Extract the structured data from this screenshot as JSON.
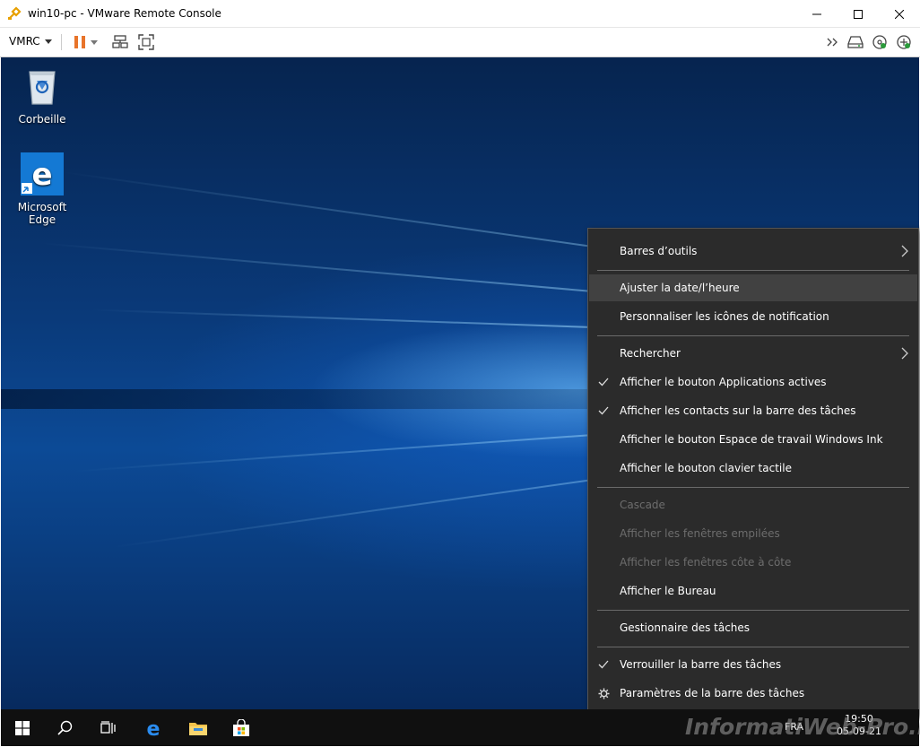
{
  "window": {
    "title": "win10-pc - VMware Remote Console"
  },
  "toolbar": {
    "vmrc_label": "VMRC"
  },
  "desktop": {
    "icons": [
      {
        "label": "Corbeille",
        "icon": "recycle-bin-icon"
      },
      {
        "label": "Microsoft Edge",
        "icon": "edge-icon"
      }
    ]
  },
  "context_menu": {
    "items": [
      {
        "label": "Barres d’outils",
        "submenu": true
      },
      {
        "label": "Ajuster la date/l’heure",
        "hover": true
      },
      {
        "label": "Personnaliser les icônes de notification"
      },
      {
        "label": "Rechercher",
        "submenu": true
      },
      {
        "label": "Afficher le bouton Applications actives",
        "checked": true
      },
      {
        "label": "Afficher les contacts sur la barre des tâches",
        "checked": true
      },
      {
        "label": "Afficher le bouton Espace de travail Windows Ink"
      },
      {
        "label": "Afficher le bouton clavier tactile"
      },
      {
        "label": "Cascade",
        "disabled": true
      },
      {
        "label": "Afficher les fenêtres empilées",
        "disabled": true
      },
      {
        "label": "Afficher les fenêtres côte à côte",
        "disabled": true
      },
      {
        "label": "Afficher le Bureau"
      },
      {
        "label": "Gestionnaire des tâches"
      },
      {
        "label": "Verrouiller la barre des tâches",
        "checked": true
      },
      {
        "label": "Paramètres de la barre des tâches",
        "icon": "gear-icon"
      }
    ]
  },
  "taskbar": {
    "language": "FRA",
    "time": "19:50",
    "date": "05-09-21"
  },
  "watermark": "InformatiWeb-Pro.net",
  "colors": {
    "menu_bg": "#2b2b2b",
    "menu_hover": "#414141",
    "pause_orange": "#e8742a",
    "taskbar_bg": "#101010"
  }
}
